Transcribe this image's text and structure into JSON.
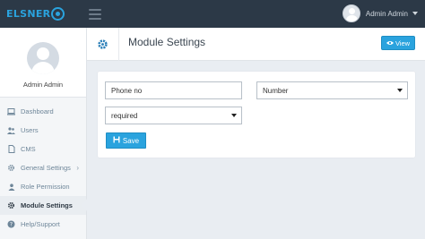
{
  "brand": {
    "name": "ELSNER"
  },
  "topbar": {
    "user_name": "Admin Admin"
  },
  "sidebar": {
    "profile_name": "Admin Admin",
    "items": [
      {
        "label": "Dashboard",
        "icon": "laptop-icon"
      },
      {
        "label": "Users",
        "icon": "users-icon"
      },
      {
        "label": "CMS",
        "icon": "document-icon"
      },
      {
        "label": "General Settings",
        "icon": "gear-icon",
        "has_submenu": true
      },
      {
        "label": "Role Permission",
        "icon": "user-icon"
      },
      {
        "label": "Module Settings",
        "icon": "gear-icon",
        "active": true
      },
      {
        "label": "Help/Support",
        "icon": "help-icon"
      }
    ]
  },
  "header": {
    "title": "Module Settings",
    "view_label": "View"
  },
  "form": {
    "name_value": "Phone no",
    "type_value": "Number",
    "required_value": "required",
    "save_label": "Save"
  },
  "colors": {
    "accent": "#2aa3de",
    "topbar": "#2c3947",
    "background": "#e9edf2"
  }
}
